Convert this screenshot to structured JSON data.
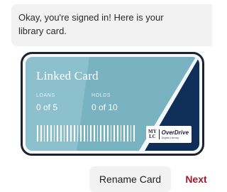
{
  "message": {
    "line1": "Okay, you're signed in! Here is your",
    "line2": "library card."
  },
  "card": {
    "title": "Linked Card",
    "loans_label": "LOANS",
    "loans_value": "0 of 5",
    "holds_label": "HOLDS",
    "holds_value": "0 of 10",
    "logo_mylc": [
      "MY",
      "LC"
    ],
    "logo_brand": "OverDrive",
    "logo_sub": "Digital Library",
    "colors": {
      "teal": "#79b2c1",
      "navy": "#0f2f58"
    }
  },
  "actions": {
    "rename_label": "Rename Card",
    "next_label": "Next",
    "next_color": "#9b1b28"
  }
}
